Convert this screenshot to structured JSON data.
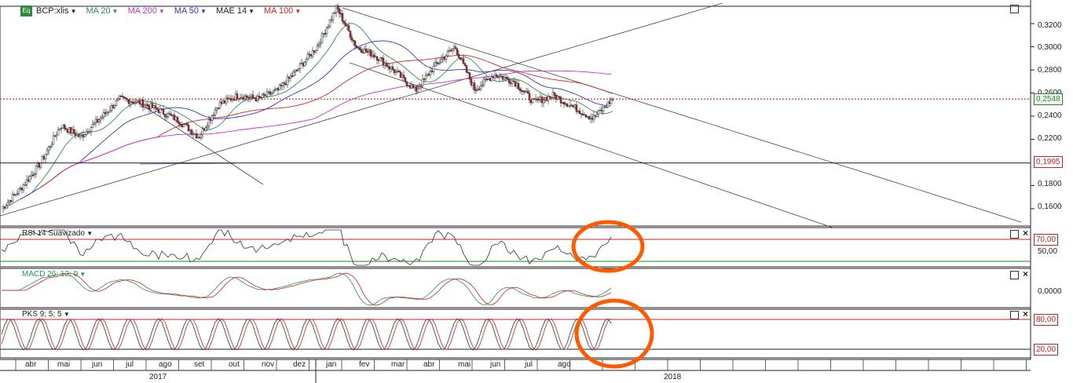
{
  "legend": {
    "symbol_icon": "eq-icon",
    "symbol_icon_text": "Eq",
    "symbol": "BCP:xlis",
    "ma20": "MA 20",
    "ma200": "MA 200",
    "ma50": "MA 50",
    "mae14": "MAE 14",
    "ma100": "MA 100",
    "colors": {
      "ma20": "#2e8b57",
      "ma200": "#cc33cc",
      "ma50": "#3333cc",
      "mae14": "#222222",
      "ma100": "#dd2222"
    }
  },
  "price_axis": {
    "ticks": [
      "0,3200",
      "0,3000",
      "0,2800",
      "0,2600",
      "0,2400",
      "0,2200",
      "0,1800",
      "0,1600"
    ],
    "last_price": "0,2548",
    "last_price_color": "#1a8a1a",
    "support_level": "0,1995",
    "support_color": "#cc2222"
  },
  "rsi_panel": {
    "label": "RSI 14 Suavizado",
    "level_high": "70,00",
    "level_mid": "50,00"
  },
  "macd_panel": {
    "label": "MACD 26; 12; 9",
    "level_zero": "0,0000"
  },
  "pks_panel": {
    "label": "PKS 9; 5; 5",
    "level_high": "80,00",
    "level_low": "20,00"
  },
  "time_axis": {
    "months": [
      "abr",
      "mai",
      "jun",
      "jul",
      "ago",
      "set",
      "out",
      "nov",
      "dez",
      "jan",
      "fev",
      "mar",
      "abr",
      "mai",
      "jun",
      "jul",
      "ago"
    ],
    "years": [
      "2017",
      "2018"
    ]
  },
  "chart_data": {
    "type": "candlestick",
    "title": "",
    "symbol": "BCP:xlis",
    "ylim": [
      0.145,
      0.335
    ],
    "x_labels": [
      "abr",
      "mai",
      "jun",
      "jul",
      "ago",
      "set",
      "out",
      "nov",
      "dez",
      "jan",
      "fev",
      "mar",
      "abr",
      "mai",
      "jun",
      "jul",
      "ago"
    ],
    "close_approx": [
      0.168,
      0.205,
      0.232,
      0.255,
      0.236,
      0.222,
      0.254,
      0.258,
      0.262,
      0.305,
      0.292,
      0.271,
      0.284,
      0.263,
      0.272,
      0.268,
      0.244,
      0.2548
    ],
    "high_approx": 0.334,
    "low_approx": 0.152,
    "last_price": 0.2548,
    "horizontal_levels": [
      {
        "value": 0.2548,
        "color": "#cc2222",
        "style": "dotted"
      },
      {
        "value": 0.1995,
        "color": "#222222"
      }
    ],
    "trendlines": "descending channel from 2018 high, ascending support line from 2017 low",
    "moving_averages": [
      "MA 20",
      "MA 50",
      "MA 100",
      "MA 200",
      "MAE 14"
    ],
    "indicators": {
      "rsi": {
        "name": "RSI 14 Suavizado",
        "levels": [
          70,
          50
        ]
      },
      "macd": {
        "name": "MACD 26; 12; 9",
        "levels": [
          0
        ]
      },
      "pks": {
        "name": "PKS 9; 5; 5",
        "levels": [
          80,
          20
        ]
      }
    },
    "annotations": [
      "orange circle on RSI near end",
      "orange circle on PKS near end"
    ]
  }
}
